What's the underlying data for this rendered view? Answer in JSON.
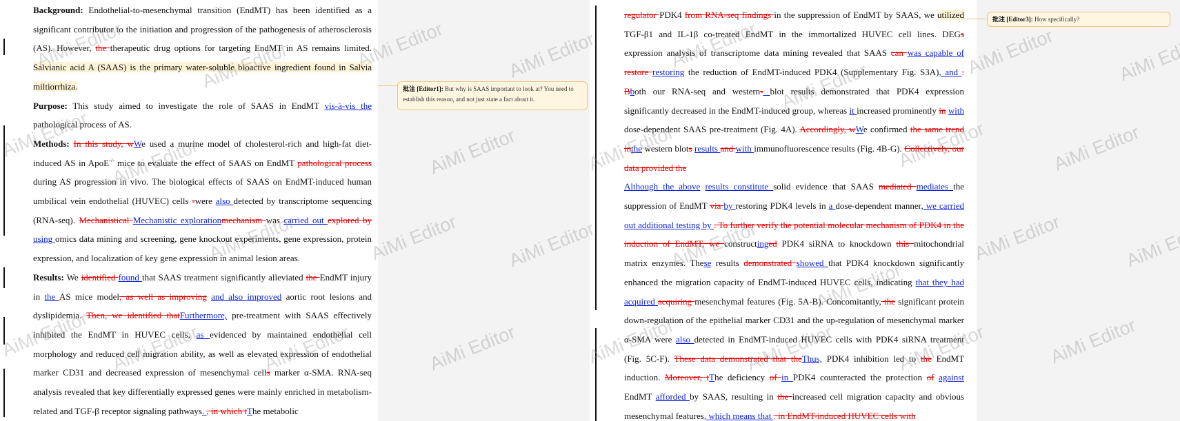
{
  "watermark": "AiMi Editor",
  "page1": {
    "p1": [
      {
        "t": "b",
        "s": "Background:"
      },
      {
        "t": "n",
        "s": " Endothelial-to-mesenchymal transition (EndMT) has been identified as a significant contributor to the initiation and progression of the pathogenesis of atherosclerosis (AS). However, "
      },
      {
        "t": "d",
        "s": "the "
      },
      {
        "t": "n",
        "s": "therapeutic drug options for targeting EndMT in AS remains limited. "
      },
      {
        "t": "h",
        "s": "Salvianic acid A (SAAS) is the primary water-soluble bioactive ingredient found in Salvia miltiorrhiza. "
      }
    ],
    "p2": [
      {
        "t": "b",
        "s": "Purpose:"
      },
      {
        "t": "n",
        "s": " This study aimed to investigate the role of SAAS in EndMT "
      },
      {
        "t": "i",
        "s": "vis-à-vis the"
      },
      {
        "t": "n",
        "s": " pathological process of AS."
      }
    ],
    "p3": [
      {
        "t": "b",
        "s": "Methods:"
      },
      {
        "t": "n",
        "s": " "
      },
      {
        "t": "d",
        "s": "In this study, w"
      },
      {
        "t": "i",
        "s": "W"
      },
      {
        "t": "n",
        "s": "e used a murine model of cholesterol-rich and high-fat diet-induced AS in ApoE"
      },
      {
        "t": "sup",
        "s": "-/-"
      },
      {
        "t": "n",
        "s": " mice to evaluate the effect of SAAS on EndMT "
      },
      {
        "t": "d",
        "s": "pathological process "
      },
      {
        "t": "n",
        "s": "during AS progression in vivo. The biological effects of SAAS on EndMT-induced human umbilical vein endothelial (HUVEC) cells "
      },
      {
        "t": "d",
        "s": "-"
      },
      {
        "t": "n",
        "s": "were "
      },
      {
        "t": "i",
        "s": "also "
      },
      {
        "t": "n",
        "s": "detected by transcriptome sequencing (RNA-seq). "
      },
      {
        "t": "d",
        "s": "Mechanistical "
      },
      {
        "t": "i",
        "s": "Mechanistic exploration"
      },
      {
        "t": "d",
        "s": "mechanism "
      },
      {
        "t": "i",
        "s": " "
      },
      {
        "t": "n",
        "s": "was "
      },
      {
        "t": "i",
        "s": "carried out "
      },
      {
        "t": "d",
        "s": "explored by "
      },
      {
        "t": "i",
        "s": "using "
      },
      {
        "t": "n",
        "s": "omics data mining and screening, gene knockout experiments, gene expression, protein expression, and localization of key gene expression in animal lesion areas."
      }
    ],
    "p4": [
      {
        "t": "b",
        "s": "Results:"
      },
      {
        "t": "n",
        "s": " We "
      },
      {
        "t": "d",
        "s": "identified "
      },
      {
        "t": "i",
        "s": "found "
      },
      {
        "t": "n",
        "s": "that SAAS treatment significantly alleviated "
      },
      {
        "t": "d",
        "s": "the "
      },
      {
        "t": "n",
        "s": "EndMT injury in "
      },
      {
        "t": "i",
        "s": "the "
      },
      {
        "t": "n",
        "s": "AS mice model"
      },
      {
        "t": "d",
        "s": ", as well as improving"
      },
      {
        "t": "n",
        "s": " "
      },
      {
        "t": "i",
        "s": "and also improved"
      },
      {
        "t": "n",
        "s": " aortic root lesions and dyslipidemia. "
      },
      {
        "t": "d",
        "s": "Then, we identified that"
      },
      {
        "t": "i",
        "s": "Furthermore,"
      },
      {
        "t": "n",
        "s": " pre-treatment with SAAS effectively inhibited the EndMT in HUVEC cells, "
      },
      {
        "t": "i",
        "s": "as "
      },
      {
        "t": "n",
        "s": "evidenced by maintained endothelial cell morphology and reduced cell migration ability, as well as elevated expression of endothelial marker CD31 and decreased expression of mesenchymal cell"
      },
      {
        "t": "d",
        "s": "s"
      },
      {
        "t": "n",
        "s": " marker α-SMA. RNA-seq analysis revealed that key differentially expressed genes were mainly enriched in metabolism-related and TGF-β receptor signaling pathways"
      },
      {
        "t": "i",
        "s": ". "
      },
      {
        "t": "d",
        "s": ", in which t"
      },
      {
        "t": "i",
        "s": "T"
      },
      {
        "t": "n",
        "s": "he metabolic"
      }
    ]
  },
  "page2": {
    "p1": [
      {
        "t": "d",
        "s": "regulator "
      },
      {
        "t": "n",
        "s": "PDK4 "
      },
      {
        "t": "d",
        "s": "from RNA-seq findings "
      },
      {
        "t": "n",
        "s": "in the suppression of EndMT by SAAS, we "
      },
      {
        "t": "h",
        "s": "utilized"
      },
      {
        "t": "n",
        "s": " TGF-β1 and IL-1β co-treated EndMT in the immortalized HUVEC cell lines. DEG"
      },
      {
        "t": "d",
        "s": "s"
      },
      {
        "t": "n",
        "s": " expression analysis of transcriptome data mining revealed that SAAS "
      },
      {
        "t": "d",
        "s": "can "
      },
      {
        "t": "i",
        "s": "was capable of"
      },
      {
        "t": "n",
        "s": " "
      },
      {
        "t": "d",
        "s": "restore "
      },
      {
        "t": "i",
        "s": "restoring"
      },
      {
        "t": "n",
        "s": " the reduction of EndMT-induced PDK4 (Supplementary Fig. S3A)"
      },
      {
        "t": "i",
        "s": ", and "
      },
      {
        "t": "d",
        "s": ". B"
      },
      {
        "t": "i",
        "s": "b"
      },
      {
        "t": "n",
        "s": "oth our RNA-seq and western"
      },
      {
        "t": "d",
        "s": "-"
      },
      {
        "t": "i",
        "s": " "
      },
      {
        "t": "n",
        "s": "blot results demonstrated that PDK4 expression significantly decreased in the EndMT-induced group, whereas "
      },
      {
        "t": "i",
        "s": "it "
      },
      {
        "t": "n",
        "s": "increased prominently "
      },
      {
        "t": "d",
        "s": "in"
      },
      {
        "t": "n",
        "s": " "
      },
      {
        "t": "i",
        "s": "with "
      },
      {
        "t": "n",
        "s": "dose-dependent SAAS pre-treatment (Fig. 4A). "
      },
      {
        "t": "d",
        "s": "Accordingly, w"
      },
      {
        "t": "i",
        "s": "W"
      },
      {
        "t": "n",
        "s": "e confirmed "
      },
      {
        "t": "d",
        "s": "the same trend in"
      },
      {
        "t": "i",
        "s": "the"
      },
      {
        "t": "n",
        "s": " western blot"
      },
      {
        "t": "d",
        "s": "s"
      },
      {
        "t": "n",
        "s": " "
      },
      {
        "t": "i",
        "s": "results "
      },
      {
        "t": "d",
        "s": "and "
      },
      {
        "t": "i",
        "s": "with "
      },
      {
        "t": "n",
        "s": "immunofluorescence results (Fig. 4B-G). "
      },
      {
        "t": "d",
        "s": "Collectively, our data provided the"
      }
    ],
    "p2": [
      {
        "t": "n",
        "s": "    "
      },
      {
        "t": "i",
        "s": "Although the above"
      },
      {
        "t": "n",
        "s": " "
      },
      {
        "t": "i",
        "s": "results constitute "
      },
      {
        "t": "n",
        "s": "solid evidence that SAAS "
      },
      {
        "t": "d",
        "s": "mediated "
      },
      {
        "t": "i",
        "s": "mediates "
      },
      {
        "t": "n",
        "s": "the suppression of EndMT "
      },
      {
        "t": "d",
        "s": "via "
      },
      {
        "t": "i",
        "s": "by "
      },
      {
        "t": "n",
        "s": "restoring PDK4 levels in "
      },
      {
        "t": "i",
        "s": "a "
      },
      {
        "t": "n",
        "s": "dose-dependent manner"
      },
      {
        "t": "i",
        "s": ", we carried out additional testing by "
      },
      {
        "t": "d",
        "s": ". To further verify the potential molecular mechanism of PDK4 in the induction of EndMT, we "
      },
      {
        "t": "n",
        "s": "construct"
      },
      {
        "t": "i",
        "s": "ing"
      },
      {
        "t": "d",
        "s": "ed"
      },
      {
        "t": "n",
        "s": " PDK4 siRNA to knockdown "
      },
      {
        "t": "d",
        "s": "this "
      },
      {
        "t": "n",
        "s": "mitochondrial matrix enzymes. The"
      },
      {
        "t": "i",
        "s": "se"
      },
      {
        "t": "n",
        "s": " results "
      },
      {
        "t": "d",
        "s": "demonstrated "
      },
      {
        "t": "i",
        "s": "showed "
      },
      {
        "t": "n",
        "s": "that PDK4 knockdown significantly enhanced the migration capacity of EndMT-induced HUVEC cells, indicating "
      },
      {
        "t": "i",
        "s": "that they had acquired "
      },
      {
        "t": "d",
        "s": "acquiring "
      },
      {
        "t": "i",
        "s": " "
      },
      {
        "t": "n",
        "s": "mesenchymal features (Fig. 5A-B). Concomitantly,"
      },
      {
        "t": "d",
        "s": " the"
      },
      {
        "t": "n",
        "s": " significant protein down-regulation of the epithelial marker CD31 and the up-regulation of mesenchymal marker α-SMA were "
      },
      {
        "t": "i",
        "s": "also "
      },
      {
        "t": "n",
        "s": "detected in EndMT-induced HUVEC cells with PDK4 siRNA treatment (Fig. 5C-F). "
      },
      {
        "t": "d",
        "s": "These data demonstrated that the"
      },
      {
        "t": "i",
        "s": "Thus,"
      },
      {
        "t": "n",
        "s": " PDK4 inhibition led to "
      },
      {
        "t": "d",
        "s": "the"
      },
      {
        "t": "n",
        "s": " EndMT induction. "
      },
      {
        "t": "d",
        "s": "Moreover, t"
      },
      {
        "t": "i",
        "s": "T"
      },
      {
        "t": "n",
        "s": "he deficiency "
      },
      {
        "t": "d",
        "s": "of "
      },
      {
        "t": "i",
        "s": "in "
      },
      {
        "t": "n",
        "s": "PDK4 counteracted the protection "
      },
      {
        "t": "d",
        "s": "of"
      },
      {
        "t": "n",
        "s": " "
      },
      {
        "t": "i",
        "s": "against "
      },
      {
        "t": "n",
        "s": "EndMT "
      },
      {
        "t": "i",
        "s": "afforded "
      },
      {
        "t": "n",
        "s": "by SAAS, resulting in "
      },
      {
        "t": "d",
        "s": "the "
      },
      {
        "t": "n",
        "s": "increased cell migration capacity and obvious mesenchymal features"
      },
      {
        "t": "i",
        "s": ", which means that "
      },
      {
        "t": "d",
        "s": ". in EndMT-induced HUVEC cells with"
      }
    ]
  },
  "comments": [
    {
      "tag": "批注 [Editor1]:",
      "body": " But why is SAAS important to look at?   You need to establish this reason, and not just state a fact about it."
    },
    {
      "tag": "批注 [Editor3]:",
      "body": " How specifically?"
    }
  ],
  "colors": {
    "deletion": "#e00000",
    "insertion": "#0b1fd8",
    "highlight": "#fdf3d7",
    "comment_border": "#f0c57a"
  }
}
